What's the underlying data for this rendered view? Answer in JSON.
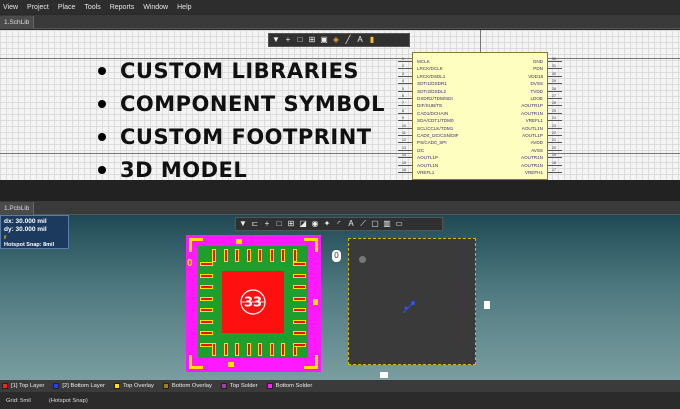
{
  "menu": [
    "View",
    "Project",
    "Place",
    "Tools",
    "Reports",
    "Window",
    "Help"
  ],
  "tabs": {
    "schematic": "1.SchLib",
    "pcb": "1.PcbLib"
  },
  "schematic_toolbar_icons": [
    "filter-icon",
    "plus-icon",
    "rect-select-icon",
    "align-icon",
    "component-icon",
    "marker-icon",
    "line-icon",
    "text-icon",
    "pin-icon"
  ],
  "pcb_toolbar_icons": [
    "filter-icon",
    "route-icon",
    "plus-icon",
    "rect-select-icon",
    "align-icon",
    "eraser-icon",
    "drop-icon",
    "pad-icon",
    "arc-icon",
    "text-icon",
    "dimension-icon",
    "square-icon",
    "bar-chart-icon",
    "fill-icon"
  ],
  "bullets": [
    "CUSTOM LIBRARIES",
    "COMPONENT SYMBOL",
    "CUSTOM FOOTPRINT",
    "3D MODEL"
  ],
  "component": {
    "left_pins": [
      "MCLK",
      "LRCK/DCLK",
      "LRCK/DSDL1",
      "SDTI1/DSDR1",
      "SDTI2/DSDL2",
      "DSDR2/TDM/SDI",
      "DIF/SUB/TE",
      "CAD1/DCHAIN",
      "SDA/CDT1/TDM0",
      "SCL/CCLK/TDM1",
      "CAD0_I2C/CSN/DIF",
      "PS/CAD0_SPI",
      "I2C",
      "AOUTL1P",
      "AOUTL1N",
      "VREFL1"
    ],
    "right_pins": [
      "GND",
      "PDN",
      "VDD18",
      "DVSS",
      "TVDD",
      "LDOE",
      "AOUTR1P",
      "AOUTR1N",
      "VREFL1",
      "AOUTL1N",
      "AOUTL1P",
      "AVDD",
      "AVSS",
      "AOUTR1N",
      "AOUTR1N",
      "VREFH1"
    ],
    "left_numbers": [
      "1",
      "2",
      "3",
      "4",
      "5",
      "6",
      "7",
      "8",
      "9",
      "10",
      "11",
      "12",
      "13",
      "14",
      "15",
      "16"
    ],
    "right_numbers": [
      "32",
      "31",
      "30",
      "29",
      "28",
      "27",
      "26",
      "25",
      "24",
      "23",
      "22",
      "21",
      "20",
      "19",
      "18",
      "17"
    ]
  },
  "coord_panel": {
    "dx": "dx:   30.000 mil",
    "dy": "dy:   30.000 mil",
    "snap": "Hotspot Snap: 8mil",
    "marker": "r"
  },
  "footprint": {
    "silk_text": "33",
    "pin1_marker": "0"
  },
  "model3d": {
    "mark": "0"
  },
  "layers": [
    {
      "label": "[1] Top Layer",
      "color": "#ff2020"
    },
    {
      "label": "[2] Bottom Layer",
      "color": "#2040ff"
    },
    {
      "label": "Top Overlay",
      "color": "#ffe000"
    },
    {
      "label": "Bottom Overlay",
      "color": "#a08020"
    },
    {
      "label": "Top Solder",
      "color": "#a040a0"
    },
    {
      "label": "Bottom Solder",
      "color": "#ff20ff"
    }
  ],
  "status": {
    "grid": "Grid: 5mil",
    "snap": "(Hotspot Snap)"
  },
  "colors": {
    "symbol_fill": "#fefec0",
    "pcb_bg": "#4f7980",
    "magenta": "#ff19ff",
    "green": "#1e9e2c",
    "red": "#ff1010"
  }
}
